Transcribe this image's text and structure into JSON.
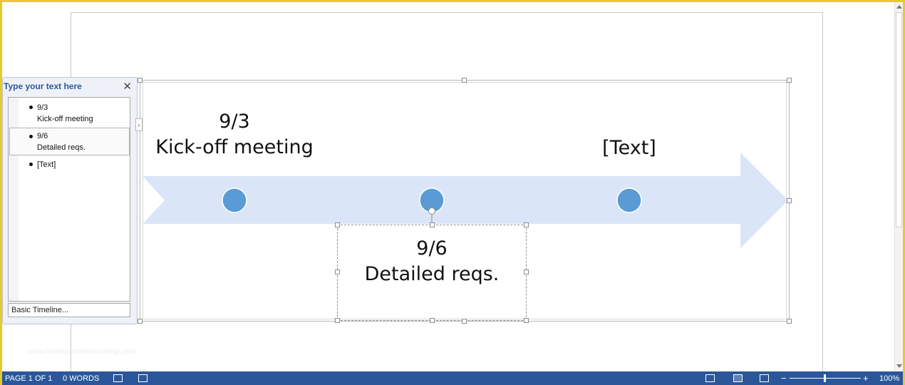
{
  "text_pane": {
    "title": "Type your text here",
    "close_glyph": "✕",
    "items": [
      {
        "line1": "9/3",
        "line2": "Kick-off meeting"
      },
      {
        "line1": "9/6",
        "line2": "Detailed reqs."
      },
      {
        "line1": "[Text]",
        "line2": ""
      }
    ],
    "layout_name": "Basic Timeline...",
    "expand_glyph": "›"
  },
  "timeline": {
    "milestones": [
      {
        "date": "9/3",
        "label": "Kick-off meeting",
        "position": "above"
      },
      {
        "date": "9/6",
        "label": "Detailed reqs.",
        "position": "below"
      },
      {
        "date": "",
        "label": "[Text]",
        "position": "above"
      }
    ],
    "colors": {
      "arrow": "#dae6f7",
      "marker": "#5b9bd5",
      "marker_border": "#ffffff"
    }
  },
  "watermark": "www.heritagechristiancollege.com",
  "status_bar": {
    "page": "PAGE 1 OF 1",
    "words": "0 WORDS",
    "zoom_minus": "−",
    "zoom_plus": "+",
    "zoom": "100%",
    "icons": [
      "proofing-icon",
      "macro-icon",
      "read-mode-icon",
      "print-layout-icon",
      "web-layout-icon"
    ],
    "background": "#2b579a"
  },
  "window": {
    "border_color": "#e8c830"
  }
}
